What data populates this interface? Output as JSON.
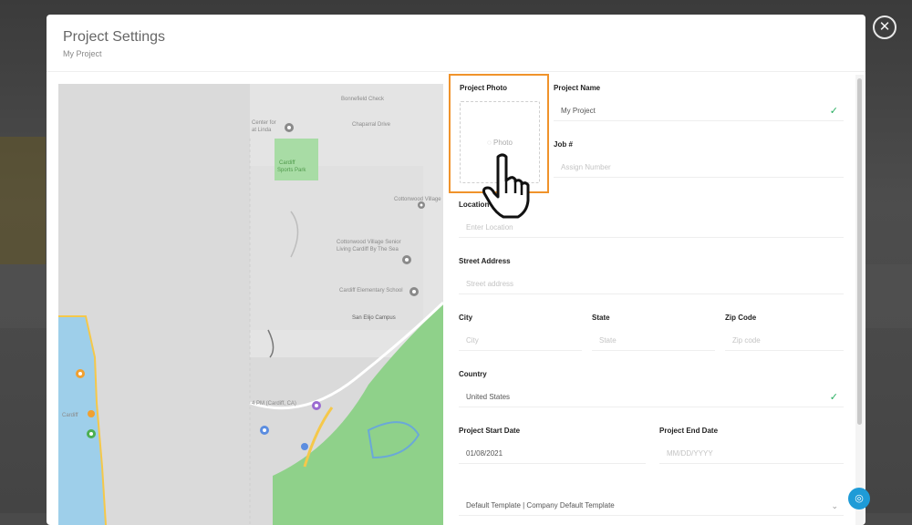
{
  "modal": {
    "title": "Project Settings",
    "subtitle": "My Project",
    "close_icon": "close-icon"
  },
  "map": {
    "labels": [
      "Bonnefield Check",
      "Chaparral Drive",
      "Center for",
      "at Linda",
      "Cardiff",
      "Sports Park",
      "Cottonwood Village",
      "Living Cardiff",
      "Cottonwood Village Senior",
      "Living Cardiff By The Sea",
      "Cardiff Elementary School",
      "San Elijo Campus",
      "4 PM (Cardiff, CA)",
      "Cardiff",
      "Cardiff"
    ]
  },
  "photo": {
    "label": "Project Photo",
    "placeholder": "Photo"
  },
  "form": {
    "project_name": {
      "label": "Project Name",
      "value": "My Project"
    },
    "job": {
      "label": "Job #",
      "placeholder": "Assign Number"
    },
    "location": {
      "label": "Location",
      "placeholder": "Enter Location"
    },
    "street": {
      "label": "Street Address",
      "placeholder": "Street address"
    },
    "city": {
      "label": "City",
      "placeholder": "City"
    },
    "state": {
      "label": "State",
      "placeholder": "State"
    },
    "zip": {
      "label": "Zip Code",
      "placeholder": "Zip code"
    },
    "country": {
      "label": "Country",
      "value": "United States"
    },
    "start_date": {
      "label": "Project Start Date",
      "value": "01/08/2021"
    },
    "end_date": {
      "label": "Project End Date",
      "placeholder": "MM/DD/YYYY"
    },
    "template": {
      "value": "Default Template | Company Default Template"
    }
  },
  "colors": {
    "accent_orange": "#f0932b",
    "check_green": "#27ae60",
    "help_blue": "#1e9bd7",
    "map_park_green": "#8fd18a"
  },
  "icons": {
    "check": "check-icon",
    "cursor": "hand-pointer-icon",
    "help": "chat-help-icon",
    "dropdown": "chevron-down-icon",
    "camera": "camera-icon"
  }
}
